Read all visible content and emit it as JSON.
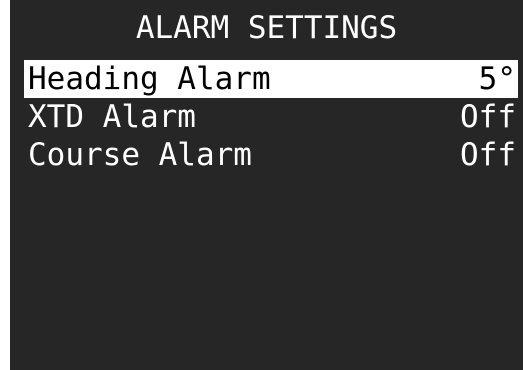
{
  "screen": {
    "title": "ALARM SETTINGS"
  },
  "menu": {
    "items": [
      {
        "label": "Heading Alarm",
        "value": "5°",
        "selected": true
      },
      {
        "label": "XTD Alarm",
        "value": "Off",
        "selected": false
      },
      {
        "label": "Course Alarm",
        "value": "Off",
        "selected": false
      }
    ]
  },
  "colors": {
    "background": "#262626",
    "text": "#ffffff",
    "highlight_bg": "#ffffff",
    "highlight_text": "#000000"
  }
}
